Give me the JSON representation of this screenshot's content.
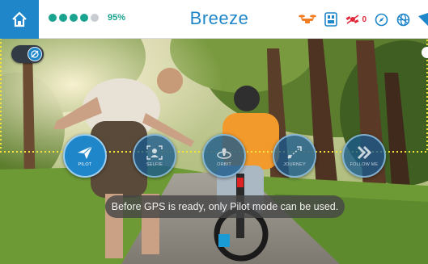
{
  "app": {
    "title": "Breeze"
  },
  "battery": {
    "percent_text": "95%",
    "level": 0.95,
    "dots_filled": 4,
    "dots_total": 5,
    "color_filled": "#1aa38f",
    "color_empty": "#c7cdd2"
  },
  "status_bar": {
    "icons": [
      "drone-icon",
      "sd-card-icon",
      "satellite-icon",
      "compass-icon",
      "globe-icon",
      "wifi-icon"
    ],
    "satellite_count": "0",
    "status_color": "#e0293a",
    "drone_color": "#f07d22"
  },
  "modes": [
    {
      "id": "pilot",
      "label": "PILOT",
      "icon": "paper-plane-icon",
      "enabled": true
    },
    {
      "id": "selfie",
      "label": "SELFIE",
      "icon": "selfie-frame-icon",
      "enabled": false
    },
    {
      "id": "orbit",
      "label": "ORBIT",
      "icon": "orbit-icon",
      "enabled": false
    },
    {
      "id": "journey",
      "label": "JOURNEY",
      "icon": "journey-icon",
      "enabled": false
    },
    {
      "id": "follow",
      "label": "FOLLOW ME",
      "icon": "chevrons-icon",
      "enabled": false
    }
  ],
  "toast": {
    "message": "Before GPS is ready, only Pilot mode can be used."
  },
  "colors": {
    "accent": "#1f86c9",
    "toast_bg": "#464646"
  }
}
